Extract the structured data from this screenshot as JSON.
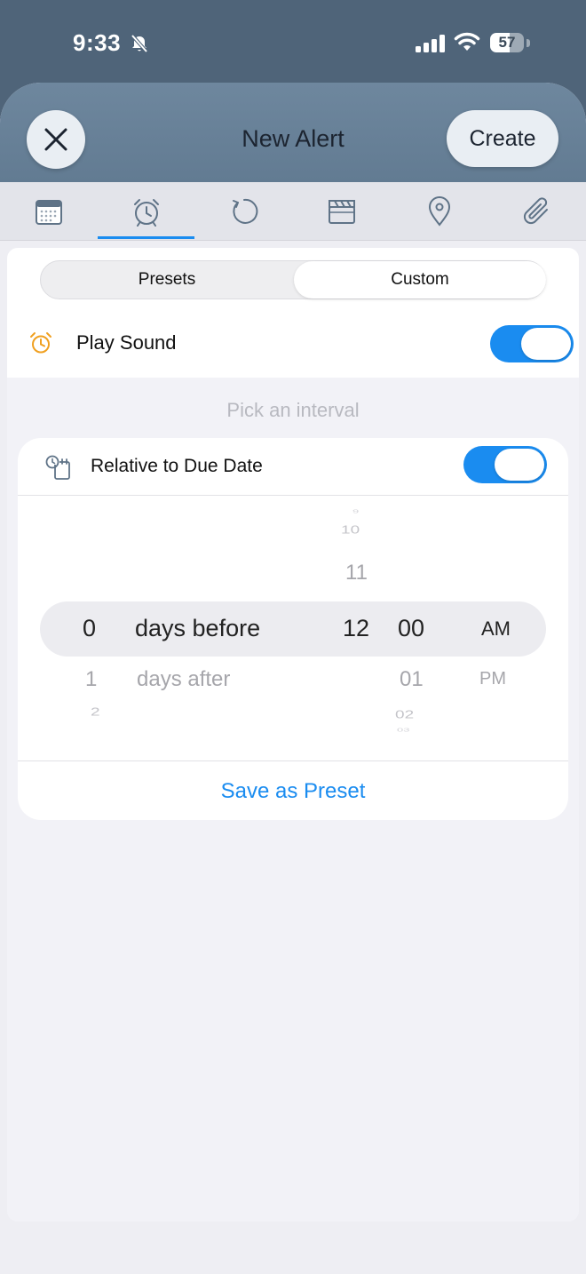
{
  "status_bar": {
    "time": "9:33",
    "battery": "57",
    "battery_level": 0.57
  },
  "sheet": {
    "title": "New Alert",
    "create_label": "Create"
  },
  "tabs": [
    {
      "icon": "calendar-icon",
      "selected": false
    },
    {
      "icon": "alarm-clock-icon",
      "selected": true
    },
    {
      "icon": "repeat-icon",
      "selected": false
    },
    {
      "icon": "clapperboard-icon",
      "selected": false
    },
    {
      "icon": "location-pin-icon",
      "selected": false
    },
    {
      "icon": "paperclip-icon",
      "selected": false
    }
  ],
  "segments": {
    "presets": "Presets",
    "custom": "Custom",
    "active": "custom"
  },
  "play_sound": {
    "label": "Play Sound",
    "on": true
  },
  "hint": "Pick an interval",
  "relative": {
    "label": "Relative to Due Date",
    "on": true
  },
  "picker": {
    "days": {
      "selected": "0",
      "below1": "1",
      "below2": "2"
    },
    "direction": {
      "selected": "days before",
      "below1": "days after"
    },
    "hours": {
      "above3": "9",
      "above2": "10",
      "above1": "11",
      "selected": "12"
    },
    "minutes": {
      "selected": "00",
      "below1": "01",
      "below2": "02",
      "below3": "03"
    },
    "period": {
      "selected": "AM",
      "below1": "PM"
    }
  },
  "save_preset_label": "Save as Preset",
  "colors": {
    "accent": "#1a8cf0",
    "header": "#627b92",
    "alarm_icon": "#f0a020"
  }
}
